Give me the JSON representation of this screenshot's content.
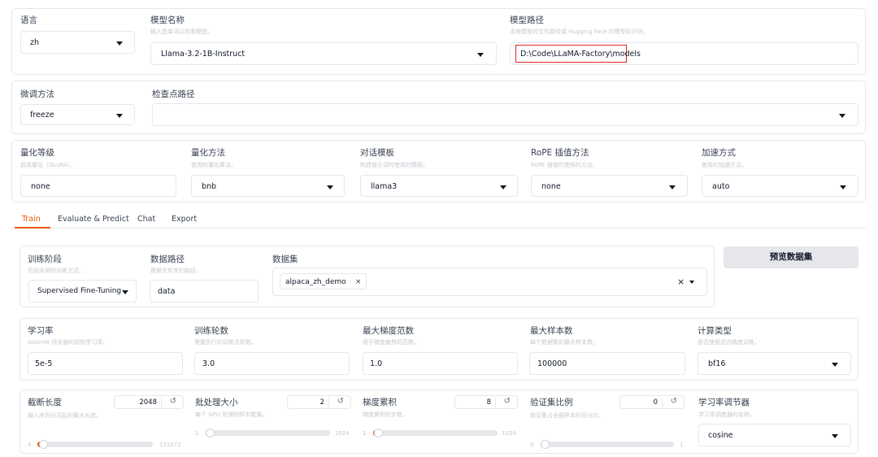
{
  "language": {
    "label": "语言",
    "value": "zh"
  },
  "model_name": {
    "label": "模型名称",
    "hint": "输入首单词以检索模型。",
    "value": "Llama-3.2-1B-Instruct"
  },
  "model_path": {
    "label": "模型路径",
    "hint": "本地模型的文件路径或 Hugging Face 的模型标识符。",
    "value": "D:\\Code\\LLaMA-Factory\\models",
    "highlight_color": "#dc2626"
  },
  "finetune": {
    "label": "微调方法",
    "value": "freeze"
  },
  "checkpoint": {
    "label": "检查点路径",
    "value": ""
  },
  "quant_bit": {
    "label": "量化等级",
    "hint": "启用量化（QLoRA）。",
    "value": "none"
  },
  "quant_method": {
    "label": "量化方法",
    "hint": "使用的量化算法。",
    "value": "bnb"
  },
  "template": {
    "label": "对话模板",
    "hint": "构建提示词时使用的模板。",
    "value": "llama3"
  },
  "rope": {
    "label": "RoPE 插值方法",
    "hint": "RoPE 插值时使用的方法。",
    "value": "none"
  },
  "booster": {
    "label": "加速方式",
    "hint": "使用的加速方法。",
    "value": "auto"
  },
  "tabs": [
    {
      "label": "Train",
      "active": true
    },
    {
      "label": "Evaluate & Predict",
      "active": false
    },
    {
      "label": "Chat",
      "active": false
    },
    {
      "label": "Export",
      "active": false
    }
  ],
  "stage": {
    "label": "训练阶段",
    "hint": "目前采用的训练方式。",
    "value": "Supervised Fine-Tuning"
  },
  "dataset_dir": {
    "label": "数据路径",
    "hint": "数据文件夹的路径。",
    "value": "data"
  },
  "dataset": {
    "label": "数据集",
    "chip": "alpaca_zh_demo",
    "chip_close": "×",
    "clear": "×"
  },
  "preview_button": "预览数据集",
  "learning_rate": {
    "label": "学习率",
    "hint": "AdamW 优化器的初始学习率。",
    "value": "5e-5"
  },
  "epochs": {
    "label": "训练轮数",
    "hint": "需要执行的训练总轮数。",
    "value": "3.0"
  },
  "max_grad_norm": {
    "label": "最大梯度范数",
    "hint": "用于梯度裁剪的范数。",
    "value": "1.0"
  },
  "max_samples": {
    "label": "最大样本数",
    "hint": "每个数据集的最大样本数。",
    "value": "100000"
  },
  "compute_type": {
    "label": "计算类型",
    "hint": "是否使用混合精度训练。",
    "value": "bf16"
  },
  "cutoff_len": {
    "label": "截断长度",
    "hint": "输入序列分词后的最大长度。",
    "value": "2048",
    "min": "4",
    "max": "131072",
    "fraction": 0.015
  },
  "batch_size": {
    "label": "批处理大小",
    "hint": "每个 GPU 处理的样本数量。",
    "value": "2",
    "min": "1",
    "max": "1024",
    "fraction": 0.001
  },
  "grad_accum": {
    "label": "梯度累积",
    "hint": "梯度累积的步数。",
    "value": "8",
    "min": "1",
    "max": "1024",
    "fraction": 0.007
  },
  "val_size": {
    "label": "验证集比例",
    "hint": "验证集占全部样本的百分比。",
    "value": "0",
    "min": "0",
    "max": "1",
    "fraction": 0.0
  },
  "lr_scheduler": {
    "label": "学习率调节器",
    "hint": "学习率调度器的名称。",
    "value": "cosine"
  },
  "reset_icon": "↺",
  "accent_color": "#ea580c"
}
